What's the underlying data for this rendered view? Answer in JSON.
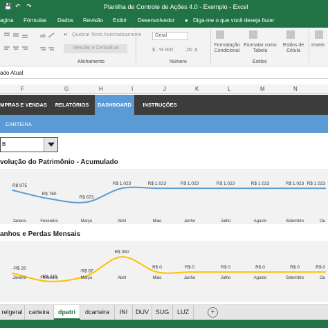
{
  "window": {
    "title": "Planilha de Controle de Ações 4.0 - Exemplo  -  Excel"
  },
  "ribbon_tabs": [
    "agina",
    "Fórmulas",
    "Dados",
    "Revisão",
    "Exibir",
    "Desenvolvedor"
  ],
  "tell_me": "Diga-me o que você deseja fazer",
  "ribbon": {
    "wrap_text": "Quebrar Texto Automaticamente",
    "merge_center": "Mesclar e Centralizar",
    "number_format": "Geral",
    "conditional_formatting": "Formatação Condicional",
    "format_as_table": "Formatar como Tabela",
    "cell_styles": "Estilos de Célula",
    "insert": "Inserir",
    "groups": {
      "alignment": "Alinhamento",
      "number": "Número",
      "styles": "Estilos"
    }
  },
  "formula_bar": {
    "text": "ado Atual"
  },
  "columns": [
    "F",
    "G",
    "H",
    "I",
    "J",
    "K",
    "L",
    "M",
    "N"
  ],
  "nav": {
    "items": [
      "MPRAS E VENDAS",
      "RELATÓRIOS",
      "DASHBOARD",
      "INSTRUÇÕES"
    ],
    "active": "DASHBOARD",
    "sub_item": "CARTEIRA"
  },
  "selector": {
    "value": "B"
  },
  "colors": {
    "excel_green": "#217346",
    "nav_dark": "#3c3c3c",
    "nav_active": "#5b9bd5",
    "line_blue": "#5b9bd5",
    "line_gold": "#ffc000"
  },
  "sheet_tabs": {
    "items": [
      "relgeral",
      "carteira",
      "dpatri",
      "dcarteira",
      "INI",
      "DUV",
      "SUG",
      "LUZ"
    ],
    "active": "dpatri"
  },
  "chart_data": [
    {
      "type": "line",
      "title": "volução do Patrimônio - Acumulado",
      "categories": [
        "Janeiro",
        "Fevereiro",
        "Março",
        "Abril",
        "Maio",
        "Junho",
        "Julho",
        "Agosto",
        "Setembro",
        "Ou"
      ],
      "values": [
        975,
        760,
        673,
        1023,
        1023,
        1023,
        1023,
        1023,
        1023,
        1023
      ],
      "labels": [
        "R$ 975",
        "R$ 760",
        "R$ 673",
        "R$ 1.023",
        "R$ 1.023",
        "R$ 1.023",
        "R$ 1.023",
        "R$ 1.023",
        "R$ 1.023",
        "R$ 1.023"
      ],
      "ylim": [
        500,
        1200
      ],
      "color": "#5b9bd5",
      "grid": false
    },
    {
      "type": "line",
      "title": "anhos e Perdas Mensais",
      "categories": [
        "Janeiro",
        "Fevereiro",
        "Março",
        "Abril",
        "Maio",
        "Junho",
        "Julho",
        "Agosto",
        "Setembro",
        "Ou"
      ],
      "values": [
        -25,
        -215,
        -87,
        350,
        0,
        0,
        0,
        0,
        0,
        0
      ],
      "labels": [
        "-R$ 25",
        "-R$ 215",
        "-R$ 87",
        "R$ 350",
        "R$ 0",
        "R$ 0",
        "R$ 0",
        "R$ 0",
        "R$ 0",
        "R$ 0"
      ],
      "ylim": [
        -300,
        400
      ],
      "color": "#ffc000",
      "grid": false
    }
  ]
}
